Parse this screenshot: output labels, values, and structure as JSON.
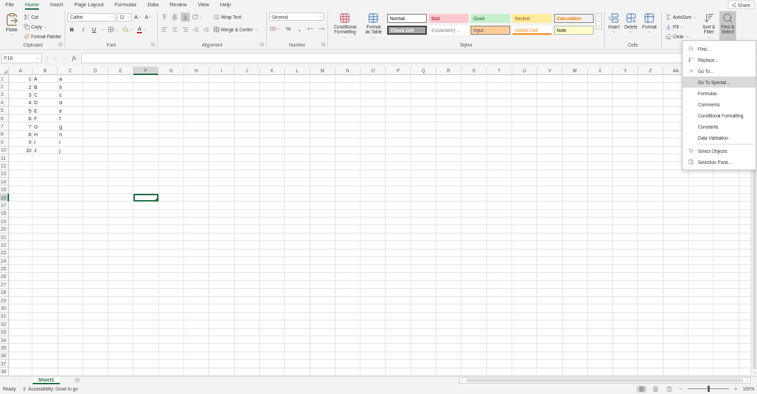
{
  "tabs": [
    {
      "label": "File",
      "selected": false
    },
    {
      "label": "Home",
      "selected": true
    },
    {
      "label": "Insert",
      "selected": false
    },
    {
      "label": "Page Layout",
      "selected": false
    },
    {
      "label": "Formulas",
      "selected": false
    },
    {
      "label": "Data",
      "selected": false
    },
    {
      "label": "Review",
      "selected": false
    },
    {
      "label": "View",
      "selected": false
    },
    {
      "label": "Help",
      "selected": false
    }
  ],
  "share": "Share",
  "clipboard": {
    "paste": "Paste",
    "cut": "Cut",
    "copy": "Copy",
    "format_painter": "Format Painter",
    "label": "Clipboard"
  },
  "font": {
    "name": "Calibri",
    "size": "11",
    "grow": "A",
    "shrink": "A",
    "bold": "B",
    "italic": "I",
    "underline": "U",
    "font_color": "A",
    "label": "Font"
  },
  "alignment": {
    "wrap_text": "Wrap Text",
    "merge": "Merge & Center",
    "label": "Alignment"
  },
  "number": {
    "format": "General",
    "percent": "%",
    "comma": ",",
    "label": "Number"
  },
  "styles": {
    "conditional": "Conditional Formatting",
    "table": "Format as Table",
    "label": "Styles",
    "cells": [
      {
        "label": "Normal",
        "kind": "normal"
      },
      {
        "label": "Bad",
        "kind": "bad"
      },
      {
        "label": "Good",
        "kind": "good"
      },
      {
        "label": "Neutral",
        "kind": "neutral"
      },
      {
        "label": "Calculation",
        "kind": "calculation"
      },
      {
        "label": "Check Cell",
        "kind": "check"
      },
      {
        "label": "Explanatory ...",
        "kind": "explanatory"
      },
      {
        "label": "Input",
        "kind": "input"
      },
      {
        "label": "Linked Cell",
        "kind": "linked"
      },
      {
        "label": "Note",
        "kind": "note"
      }
    ]
  },
  "cells_group": {
    "label": "Cells",
    "buttons": [
      {
        "label": "Insert",
        "kind": "insert"
      },
      {
        "label": "Delete",
        "kind": "delete"
      },
      {
        "label": "Format",
        "kind": "format"
      }
    ]
  },
  "editing": {
    "autosum": "AutoSum",
    "fill": "Fill",
    "clear": "Clear",
    "sort": "Sort & Filter",
    "find": "Find & Select",
    "find_pressed": true
  },
  "formula_bar": {
    "name_box": "F16",
    "function_label": "fx"
  },
  "sheet": {
    "columns": [
      {
        "label": "A",
        "selected": false
      },
      {
        "label": "B",
        "selected": false
      },
      {
        "label": "C",
        "selected": false
      },
      {
        "label": "D",
        "selected": false
      },
      {
        "label": "E",
        "selected": false
      },
      {
        "label": "F",
        "selected": true
      },
      {
        "label": "G",
        "selected": false
      },
      {
        "label": "H",
        "selected": false
      },
      {
        "label": "I",
        "selected": false
      },
      {
        "label": "J",
        "selected": false
      },
      {
        "label": "K",
        "selected": false
      },
      {
        "label": "L",
        "selected": false
      },
      {
        "label": "M",
        "selected": false
      },
      {
        "label": "N",
        "selected": false
      },
      {
        "label": "O",
        "selected": false
      },
      {
        "label": "P",
        "selected": false
      },
      {
        "label": "Q",
        "selected": false
      },
      {
        "label": "R",
        "selected": false
      },
      {
        "label": "S",
        "selected": false
      },
      {
        "label": "T",
        "selected": false
      },
      {
        "label": "U",
        "selected": false
      },
      {
        "label": "V",
        "selected": false
      },
      {
        "label": "W",
        "selected": false
      },
      {
        "label": "X",
        "selected": false
      },
      {
        "label": "Y",
        "selected": false
      },
      {
        "label": "Z",
        "selected": false
      },
      {
        "label": "AA",
        "selected": false
      }
    ],
    "rows": [
      {
        "label": "1",
        "selected": false
      },
      {
        "label": "2",
        "selected": false
      },
      {
        "label": "3",
        "selected": false
      },
      {
        "label": "4",
        "selected": false
      },
      {
        "label": "5",
        "selected": false
      },
      {
        "label": "6",
        "selected": false
      },
      {
        "label": "7",
        "selected": false
      },
      {
        "label": "8",
        "selected": false
      },
      {
        "label": "9",
        "selected": false
      },
      {
        "label": "10",
        "selected": false
      },
      {
        "label": "11",
        "selected": false
      },
      {
        "label": "12",
        "selected": false
      },
      {
        "label": "13",
        "selected": false
      },
      {
        "label": "14",
        "selected": false
      },
      {
        "label": "15",
        "selected": false
      },
      {
        "label": "16",
        "selected": true
      },
      {
        "label": "17",
        "selected": false
      },
      {
        "label": "18",
        "selected": false
      },
      {
        "label": "19",
        "selected": false
      },
      {
        "label": "20",
        "selected": false
      },
      {
        "label": "21",
        "selected": false
      },
      {
        "label": "22",
        "selected": false
      },
      {
        "label": "23",
        "selected": false
      },
      {
        "label": "24",
        "selected": false
      },
      {
        "label": "25",
        "selected": false
      },
      {
        "label": "26",
        "selected": false
      },
      {
        "label": "27",
        "selected": false
      },
      {
        "label": "28",
        "selected": false
      },
      {
        "label": "29",
        "selected": false
      },
      {
        "label": "30",
        "selected": false
      },
      {
        "label": "31",
        "selected": false
      },
      {
        "label": "32",
        "selected": false
      },
      {
        "label": "33",
        "selected": false
      },
      {
        "label": "34",
        "selected": false
      },
      {
        "label": "35",
        "selected": false
      },
      {
        "label": "36",
        "selected": false
      },
      {
        "label": "37",
        "selected": false
      },
      {
        "label": "38",
        "selected": false
      }
    ],
    "data": [
      [
        "1",
        "A",
        "a"
      ],
      [
        "2",
        "B",
        "b"
      ],
      [
        "3",
        "C",
        "c"
      ],
      [
        "4",
        "D",
        "d"
      ],
      [
        "5",
        "E",
        "e"
      ],
      [
        "6",
        "F",
        "f"
      ],
      [
        "7",
        "G",
        "g"
      ],
      [
        "8",
        "H",
        "h"
      ],
      [
        "9",
        "I",
        "i"
      ],
      [
        "10",
        "J",
        "j"
      ]
    ]
  },
  "sheet_tabs": [
    {
      "label": "Sheet1",
      "selected": true
    }
  ],
  "status": {
    "ready": "Ready",
    "accessibility": "Accessibility: Good to go",
    "zoom": "100%"
  },
  "zoom_slider": {
    "level": 0.5
  },
  "find_menu": {
    "items": [
      {
        "label": "Find...",
        "kind": "find",
        "selected": false,
        "separator_before": false
      },
      {
        "label": "Replace...",
        "kind": "replace",
        "selected": false,
        "separator_before": false
      },
      {
        "label": "Go To...",
        "kind": "goto",
        "selected": false,
        "separator_before": false
      },
      {
        "label": "Go To Special...",
        "kind": "plain",
        "selected": true,
        "separator_before": false
      },
      {
        "label": "Formulas",
        "kind": "plain",
        "selected": false,
        "separator_before": false
      },
      {
        "label": "Comments",
        "kind": "plain",
        "selected": false,
        "separator_before": false
      },
      {
        "label": "Conditional Formatting",
        "kind": "plain",
        "selected": false,
        "separator_before": false
      },
      {
        "label": "Constants",
        "kind": "plain",
        "selected": false,
        "separator_before": false
      },
      {
        "label": "Data Validation",
        "kind": "plain",
        "selected": false,
        "separator_before": false
      },
      {
        "label": "Select Objects",
        "kind": "select",
        "selected": false,
        "separator_before": true
      },
      {
        "label": "Selection Pane...",
        "kind": "pane",
        "selected": false,
        "separator_before": false
      }
    ]
  }
}
